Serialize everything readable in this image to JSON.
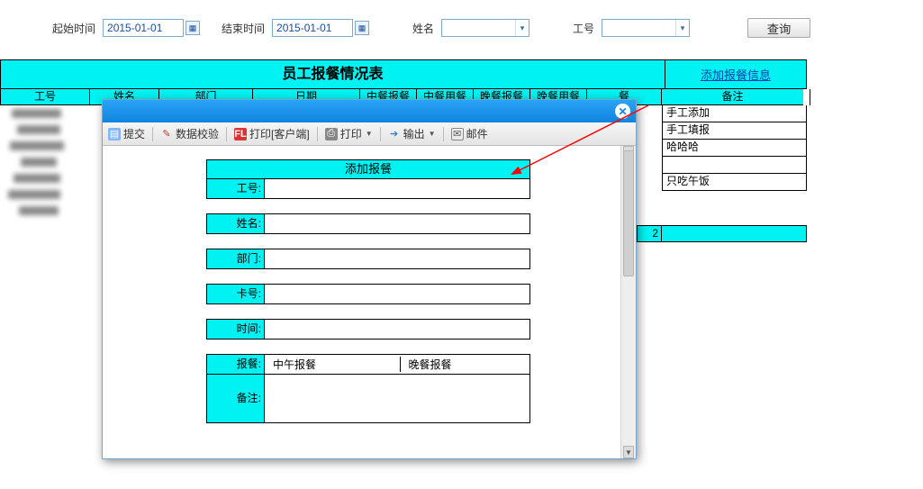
{
  "filter": {
    "start_label": "起始时间",
    "end_label": "结束时间",
    "start_value": "2015-01-01",
    "end_value": "2015-01-01",
    "name_label": "姓名",
    "empno_label": "工号",
    "query_btn": "查询"
  },
  "report": {
    "title": "员工报餐情况表",
    "add_link": "添加报餐信息",
    "headers": {
      "empno": "工号",
      "name": "姓名",
      "dept": "部门",
      "date": "日期",
      "lunch_plan": "中餐报餐",
      "lunch_used": "中餐用餐",
      "dinner_plan": "晚餐报餐",
      "dinner_used": "晚餐用餐",
      "meal": "餐",
      "remark": "备注"
    },
    "remarks": [
      "手工添加",
      "手工填报",
      "哈哈哈",
      "",
      "只吃午饭"
    ],
    "total_count": "2"
  },
  "toolbar": {
    "submit": "提交",
    "validate": "数据校验",
    "print_client": "打印[客户端]",
    "print": "打印",
    "export": "输出",
    "mail": "邮件"
  },
  "form": {
    "title": "添加报餐",
    "labels": {
      "empno": "工号:",
      "name": "姓名:",
      "dept": "部门:",
      "cardno": "卡号:",
      "time": "时间:",
      "meal": "报餐:",
      "remark": "备注:"
    },
    "meal_opts": {
      "lunch": "中午报餐",
      "dinner": "晚餐报餐"
    }
  }
}
